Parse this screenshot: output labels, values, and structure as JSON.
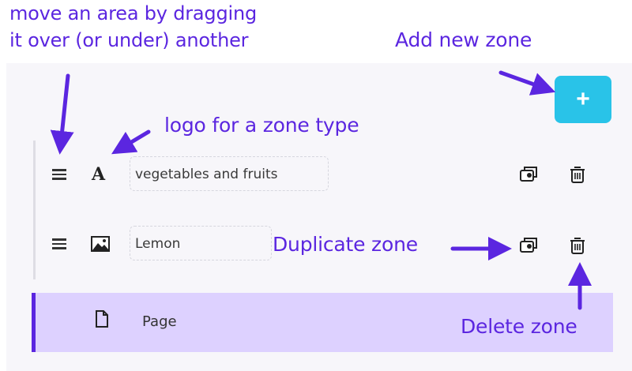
{
  "annotations": {
    "drag_line1": "move an area by dragging",
    "drag_line2": "it over (or under) another",
    "add_zone": "Add new zone",
    "logo": "logo for a zone type",
    "duplicate": "Duplicate zone",
    "delete": "Delete zone"
  },
  "toolbar": {
    "add_label": "+"
  },
  "zones": [
    {
      "type": "text",
      "type_icon": "text-type-icon",
      "type_glyph": "A",
      "value": "vegetables and fruits"
    },
    {
      "type": "image",
      "type_icon": "image-type-icon",
      "value": "Lemon"
    }
  ],
  "page": {
    "icon": "page-icon",
    "label": "Page"
  },
  "icons": {
    "drag": "drag-handle-icon",
    "duplicate": "duplicate-icon",
    "delete": "trash-icon"
  },
  "colors": {
    "annotation": "#5b26e0",
    "add_button": "#29c3e8",
    "page_highlight": "#ddd1ff",
    "page_accent": "#5b26e0"
  }
}
